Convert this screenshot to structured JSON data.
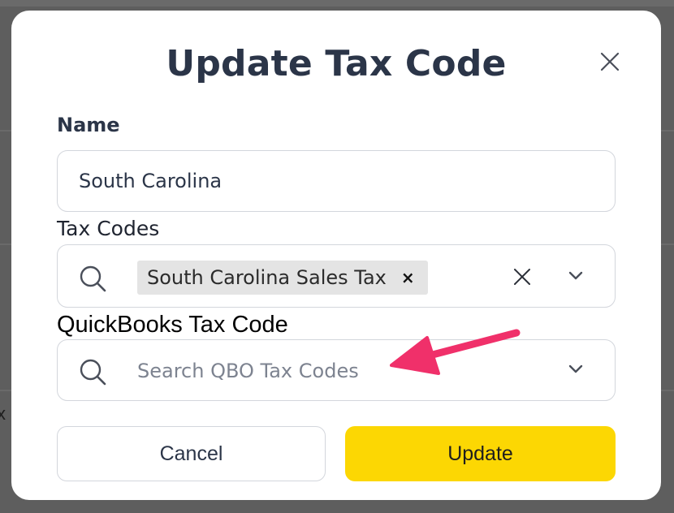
{
  "modal": {
    "title": "Update Tax Code",
    "close_icon": "close-icon"
  },
  "name_field": {
    "label": "Name",
    "value": "South Carolina"
  },
  "tax_codes": {
    "label": "Tax Codes",
    "selected": [
      "South Carolina Sales Tax"
    ],
    "chip_remove": "×",
    "icons": [
      "search-icon",
      "clear-icon",
      "chevron-down-icon"
    ]
  },
  "qbo_tax_code": {
    "label": "QuickBooks Tax Code",
    "placeholder": "Search QBO Tax Codes",
    "value": "",
    "icons": [
      "search-icon",
      "chevron-down-icon"
    ]
  },
  "actions": {
    "cancel_label": "Cancel",
    "update_label": "Update"
  },
  "backdrop": {
    "partial_text": "x"
  },
  "colors": {
    "primary_button": "#fcd703",
    "title_text": "#2b3548",
    "border": "#d3d6dc",
    "annotation_arrow": "#f0306a",
    "chip_bg": "#e4e4e4",
    "overlay": "#5e5e5e"
  }
}
